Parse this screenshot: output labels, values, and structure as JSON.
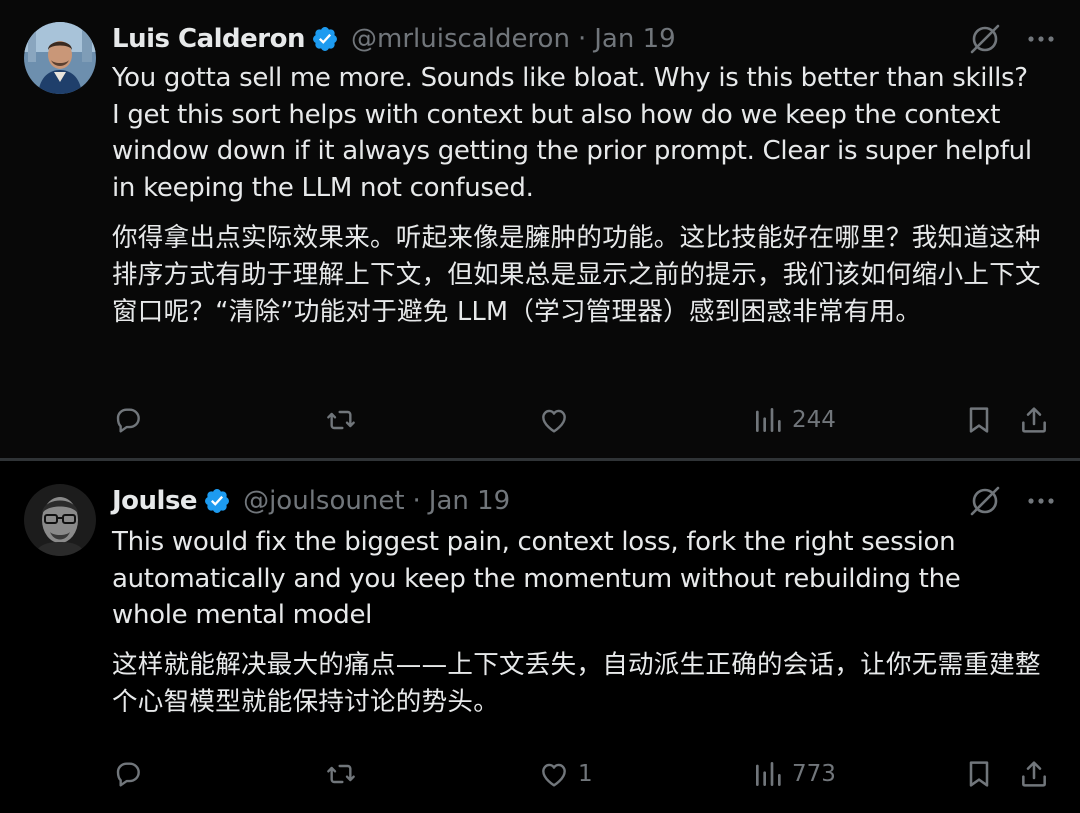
{
  "tweets": [
    {
      "name": "Luis Calderon",
      "handle": "@mrluiscalderon",
      "separator": "·",
      "date": "Jan 19",
      "text_en": "You gotta sell me more. Sounds like bloat. Why is this better than skills? I get this sort helps with context but also how do we keep the context window down if it always getting the prior prompt. Clear is super helpful in keeping the LLM not confused.",
      "text_zh": "你得拿出点实际效果来。听起来像是臃肿的功能。这比技能好在哪里？我知道这种排序方式有助于理解上下文，但如果总是显示之前的提示，我们该如何缩小上下文窗口呢？“清除”功能对于避免 LLM（学习管理器）感到困惑非常有用。",
      "likes": "",
      "views": "244"
    },
    {
      "name": "Joulse",
      "handle": "@joulsounet",
      "separator": "·",
      "date": "Jan 19",
      "text_en": "This would fix the biggest pain, context loss, fork the right session automatically and you keep the momentum without rebuilding the whole mental model",
      "text_zh": "这样就能解决最大的痛点——上下文丢失，自动派生正确的会话，让你无需重建整个心智模型就能保持讨论的势头。",
      "likes": "1",
      "views": "773"
    }
  ],
  "colors": {
    "text": "#e7e9ea",
    "muted": "#71767b",
    "verified": "#1d9bf0",
    "divider": "#2f3336"
  }
}
